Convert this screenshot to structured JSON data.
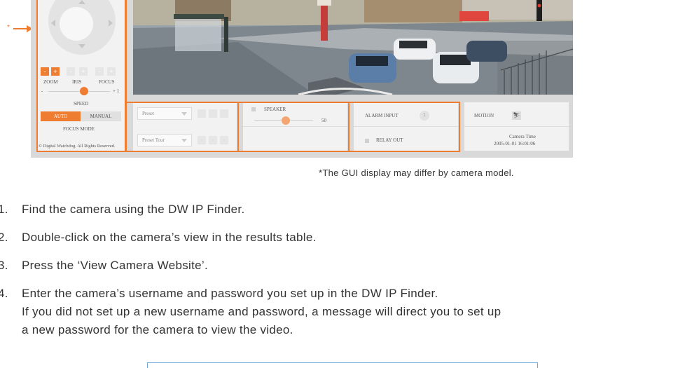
{
  "callout": {
    "marker": "*"
  },
  "gui": {
    "ptz": {
      "zoom_minus": "-",
      "zoom_plus": "+",
      "iris_minus": "-",
      "iris_plus": "+",
      "focus_minus": "-",
      "focus_plus": "+",
      "zoom_label": "ZOOM",
      "iris_label": "IRIS",
      "focus_label": "FOCUS",
      "slider_min": "-",
      "slider_max": "+ 1",
      "speed_label": "SPEED",
      "mode_auto": "AUTO",
      "mode_manual": "MANUAL",
      "focus_mode_label": "FOCUS MODE",
      "copyright": "© Digital Watchdog. All Rights Reserved."
    },
    "preset": {
      "preset_select": "Preset",
      "preset_tour_select": "Preset Tour"
    },
    "speaker": {
      "label": "SPEAKER",
      "volume": "50"
    },
    "alarm": {
      "alarm_input": "ALARM INPUT",
      "alarm_badge": "1",
      "relay_out": "RELAY OUT"
    },
    "motion": {
      "label": "MOTION",
      "icon_glyph": "⛷"
    },
    "camera_time": {
      "label": "Camera Time",
      "value": "2005-01-01 16:01:06"
    }
  },
  "note": "*The GUI display may differ by camera model.",
  "steps": [
    {
      "num": "1.",
      "text": "Find the camera using the DW IP Finder."
    },
    {
      "num": "2.",
      "text": "Double-click on the camera’s view in the results table."
    },
    {
      "num": "3.",
      "text": "Press the ‘View Camera Website’."
    },
    {
      "num": "4.",
      "lines": [
        "Enter the camera’s username and password you set up in the DW IP Finder.",
        "If you did not set up a new username and password, a message will direct you to set up",
        "a new password for the camera to view the video."
      ]
    }
  ],
  "colors": {
    "accent": "#ef7d31",
    "panel": "#f2f2f2",
    "frame": "#d9d9d9",
    "login_border": "#6fa8dc"
  }
}
